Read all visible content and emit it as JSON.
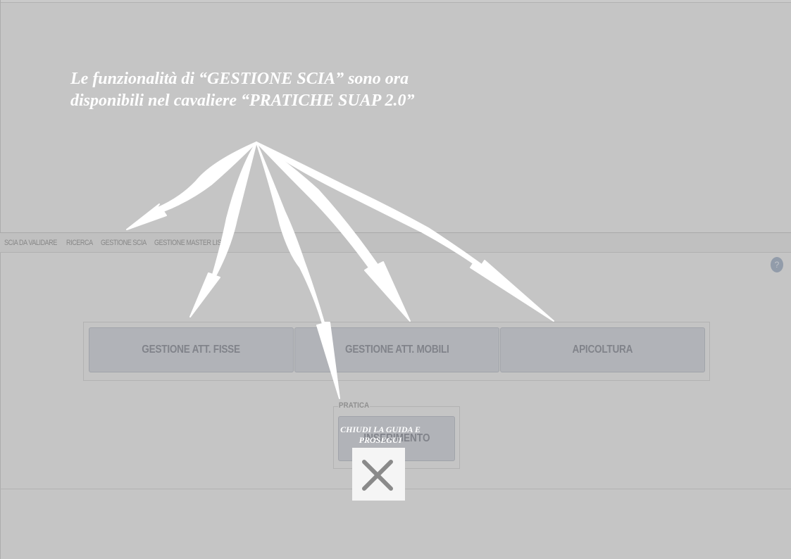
{
  "nav": {
    "items": [
      "SCIA DA VALIDARE",
      "RICERCA",
      "GESTIONE SCIA",
      "GESTIONE MASTER LIST"
    ]
  },
  "help": {
    "label": "?"
  },
  "buttons": [
    {
      "label": "GESTIONE ATT. FISSE"
    },
    {
      "label": "GESTIONE ATT. MOBILI"
    },
    {
      "label": "APICOLTURA"
    }
  ],
  "pratica": {
    "legend": "PRATICA",
    "button_label": "INSERIMENTO"
  },
  "guide": {
    "line1": "Le funzionalità di “GESTIONE SCIA” sono ora",
    "line2": "disponibili nel cavaliere “PRATICHE SUAP  2.0”",
    "close_label": "CHIUDI LA GUIDA E PROSEGUI",
    "close_icon": "close-icon"
  },
  "colors": {
    "overlay": "#969696",
    "button_bg": "#c6cbd3",
    "help_badge": "#8fa0bb"
  }
}
